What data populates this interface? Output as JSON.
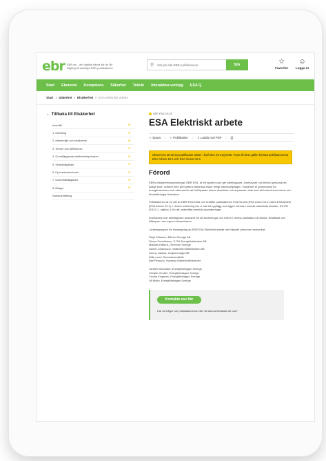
{
  "header": {
    "logo": "ebr",
    "tagline": "EBR.se – din digitala tjänst där du får tillgång till samtliga EBR-publikationer",
    "search_placeholder": "Sök på alla EBR-publikationer",
    "search_button": "Sök",
    "favorites_label": "Favoriter",
    "login_label": "Logga ut"
  },
  "nav": {
    "items": [
      "Start",
      "Ekonomi",
      "Kompetens",
      "Säkerhet",
      "Teknik",
      "Interaktiva verktyg",
      "ESA Q"
    ]
  },
  "breadcrumb": {
    "items": [
      "Start",
      "Säkerhet",
      "Elsäkerhet"
    ],
    "current": "ESA Elektriskt arbete"
  },
  "sidebar": {
    "back_label": "Tillbaka till Elsäkerhet",
    "toc": [
      "Innehåll",
      "1. Inledning",
      "2. Arbetsmiljö och elsäkerhet",
      "3. Termer och definitioner",
      "4. Grundläggande elsäkerhetsprinciper",
      "5. Skötselåtgärder",
      "6. Fyra arbetsmetoder",
      "7. Underhållsåtgärder",
      "8. Bilagor",
      "Sammanfattning"
    ]
  },
  "main": {
    "tag": "EBR ESA EA:26",
    "title": "ESA Elektriskt arbete",
    "actions": {
      "save": "Spara",
      "publication": "Publikation",
      "pdf": "Ladda ned PDF"
    },
    "notice": "Observera att denna publikation träder i kraft den 29 maj 2026. Fram till dess gäller fortsatt publikationerna ESA Arbete 19.1 och ESA Grund 19.1",
    "heading": "Förord",
    "paragraphs": [
      "EBRs elsäkerhetsanvisningar, EBR ESA, är ett system som ger arbetsgivare, innehavare och berörd personal ett tydligt stöd i arbetet med att hantera elektriska risker enligt arbetsmiljölagen. Systemet är gemensamt för energibranschen och utformat för att fortlöpande kunna utvecklas och anpassas i takt med att branschens behov och förutsättningar förändras.",
      "Publikationen är en del av EBR ESA 2026 och ersätter publikationen ESA Grund (ESA Grund 19.1) samt ESA Arbete (ESA Arbete 19.1). I denna revidering har vi valt ett upplägg som ligger närmare svensk standards struktur, SS-EN 50110-1, utgåva 4, för att underlätta framtida uppdateringar.",
      "Innehavare och arbetsgivare ansvarar för att anvisningar och rutiner i denna publikation är kända, förstådda och tillämpas i den egna verksamheten.",
      "I arbetsgruppen för framtagning av EBR ESA Elektriskt arbete har följande personer medverkat:"
    ],
    "members_1": [
      "Reijo Eriksson, Ellevio Sverige AB",
      "Simon Fredriksson, E.ON Energidistribution AB",
      "Mathias Hällerä, Omexom Sverige",
      "Daniel Johansson, Vattenfall Eldistribution AB",
      "Jimmy Laukas, Unijemomage AB",
      "Willy Lund, Svenska kraftnät",
      "Åke Persson, Svenska Elektrikerförbundet"
    ],
    "members_2": [
      "Torsten Brönmark, Energiföretagen Sverige",
      "Christer Gruber, Energiföretagen Sverige",
      "Cecilia Klugman, Energiföretagen Sverige",
      "Ulf Melin, Energiföretagen Sverige"
    ],
    "contact": {
      "button": "Kontakta oss här",
      "text": "Har du frågor om publikationerna eller vill lämna feedback till oss?"
    }
  },
  "colors": {
    "brand_green": "#6cc04a",
    "notice_yellow": "#f6c700",
    "accent_dot": "#f5c400"
  }
}
